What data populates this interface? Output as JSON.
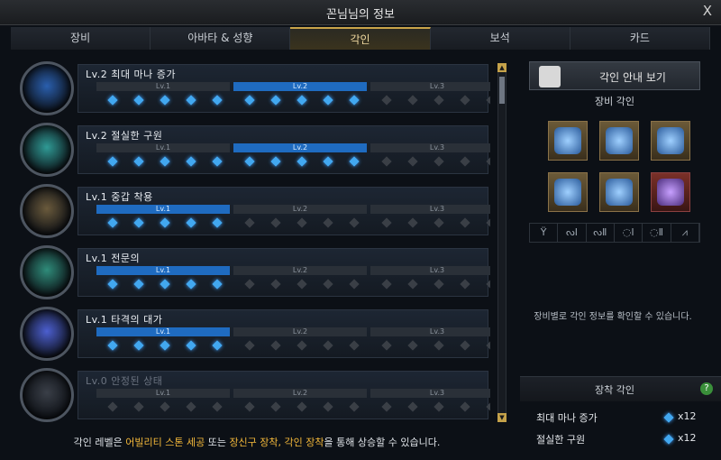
{
  "window": {
    "title": "꼰님님의 정보",
    "close": "X"
  },
  "tabs": [
    "장비",
    "아바타 & 성향",
    "각인",
    "보석",
    "카드"
  ],
  "active_tab": 2,
  "level_labels": [
    "Lv.1",
    "Lv.2",
    "Lv.3"
  ],
  "engravings": [
    {
      "title": "Lv.2 최대 마나 증가",
      "level": 2,
      "gems": 10,
      "color": "#2a5fae"
    },
    {
      "title": "Lv.2 절실한 구원",
      "level": 2,
      "gems": 10,
      "color": "#2f9a95"
    },
    {
      "title": "Lv.1 중갑 착용",
      "level": 1,
      "gems": 5,
      "color": "#6a5a3c"
    },
    {
      "title": "Lv.1 전문의",
      "level": 1,
      "gems": 5,
      "color": "#2f8c7a"
    },
    {
      "title": "Lv.1 타격의 대가",
      "level": 1,
      "gems": 5,
      "color": "#4c5fd0"
    },
    {
      "title": "Lv.0 안정된 상태",
      "level": 0,
      "gems": 0,
      "color": "#3a3f48"
    }
  ],
  "guide_button": "각인 안내 보기",
  "equip_section_title": "장비 각인",
  "slot_icons": [
    "Ϋ",
    "ᔓⅠ",
    "ᔓⅡ",
    "◌Ⅰ",
    "◌Ⅱ",
    "⩘"
  ],
  "equip_info": "장비별로 각인 정보를 확인할 수 있습니다.",
  "equipped": {
    "title": "장착 각인",
    "help": "?",
    "items": [
      {
        "name": "최대 마나 증가",
        "count": "x12"
      },
      {
        "name": "절실한 구원",
        "count": "x12"
      }
    ]
  },
  "footer": {
    "p1": "각인 레벨은 ",
    "h1": "어빌리티 스톤 세공",
    "p2": " 또는 ",
    "h2": "장신구 장착, 각인 장착",
    "p3": "을 통해 상승할 수 있습니다."
  },
  "scroll": {
    "up": "▲",
    "down": "▼"
  }
}
